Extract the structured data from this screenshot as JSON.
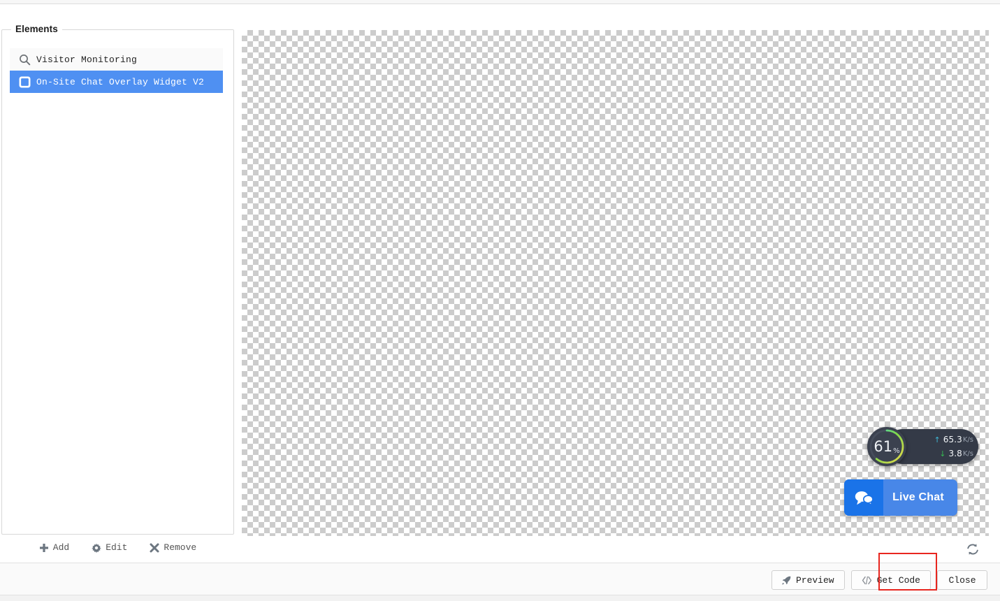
{
  "panel": {
    "legend": "Elements",
    "items": [
      {
        "icon": "search-icon",
        "label": "Visitor Monitoring",
        "selected": false
      },
      {
        "icon": "checkbox-icon",
        "label": "On-Site Chat Overlay Widget V2",
        "selected": true
      }
    ]
  },
  "actions": {
    "add": {
      "label": "Add",
      "icon": "plus-icon"
    },
    "edit": {
      "label": "Edit",
      "icon": "gear-icon"
    },
    "remove": {
      "label": "Remove",
      "icon": "x-icon"
    },
    "refresh": {
      "icon": "refresh-icon"
    }
  },
  "canvas": {
    "network_widget": {
      "percent": "61",
      "percent_sign": "%",
      "upload_value": "65.3",
      "upload_unit": "K/s",
      "download_value": "3.8",
      "download_unit": "K/s",
      "upload_arrow": "↑",
      "download_arrow": "↓",
      "gauge_fill_percent": 61,
      "colors": {
        "pill_bg": "#343a47",
        "gauge_bg": "#3b414f",
        "arc_start": "#3fd2c7",
        "arc_mid": "#7fd94a",
        "arc_end": "#e8d84a",
        "upload_arrow_color": "#3fb6d3",
        "download_arrow_color": "#36b551"
      }
    },
    "live_chat": {
      "label": "Live Chat",
      "icon": "chat-bubbles-icon",
      "colors": {
        "icon_bg": "#1a73e8",
        "body_bg": "#4887e8",
        "text": "#ffffff"
      }
    }
  },
  "footer": {
    "preview": {
      "label": "Preview",
      "icon": "rocket-icon"
    },
    "get_code": {
      "label": "Get Code",
      "icon": "code-tags-icon"
    },
    "close": {
      "label": "Close"
    }
  },
  "highlight": {
    "target": "get-code-button",
    "color": "#e8261f"
  },
  "theme": {
    "selection_blue": "#4f90f2",
    "row_bg": "#fafafa"
  }
}
